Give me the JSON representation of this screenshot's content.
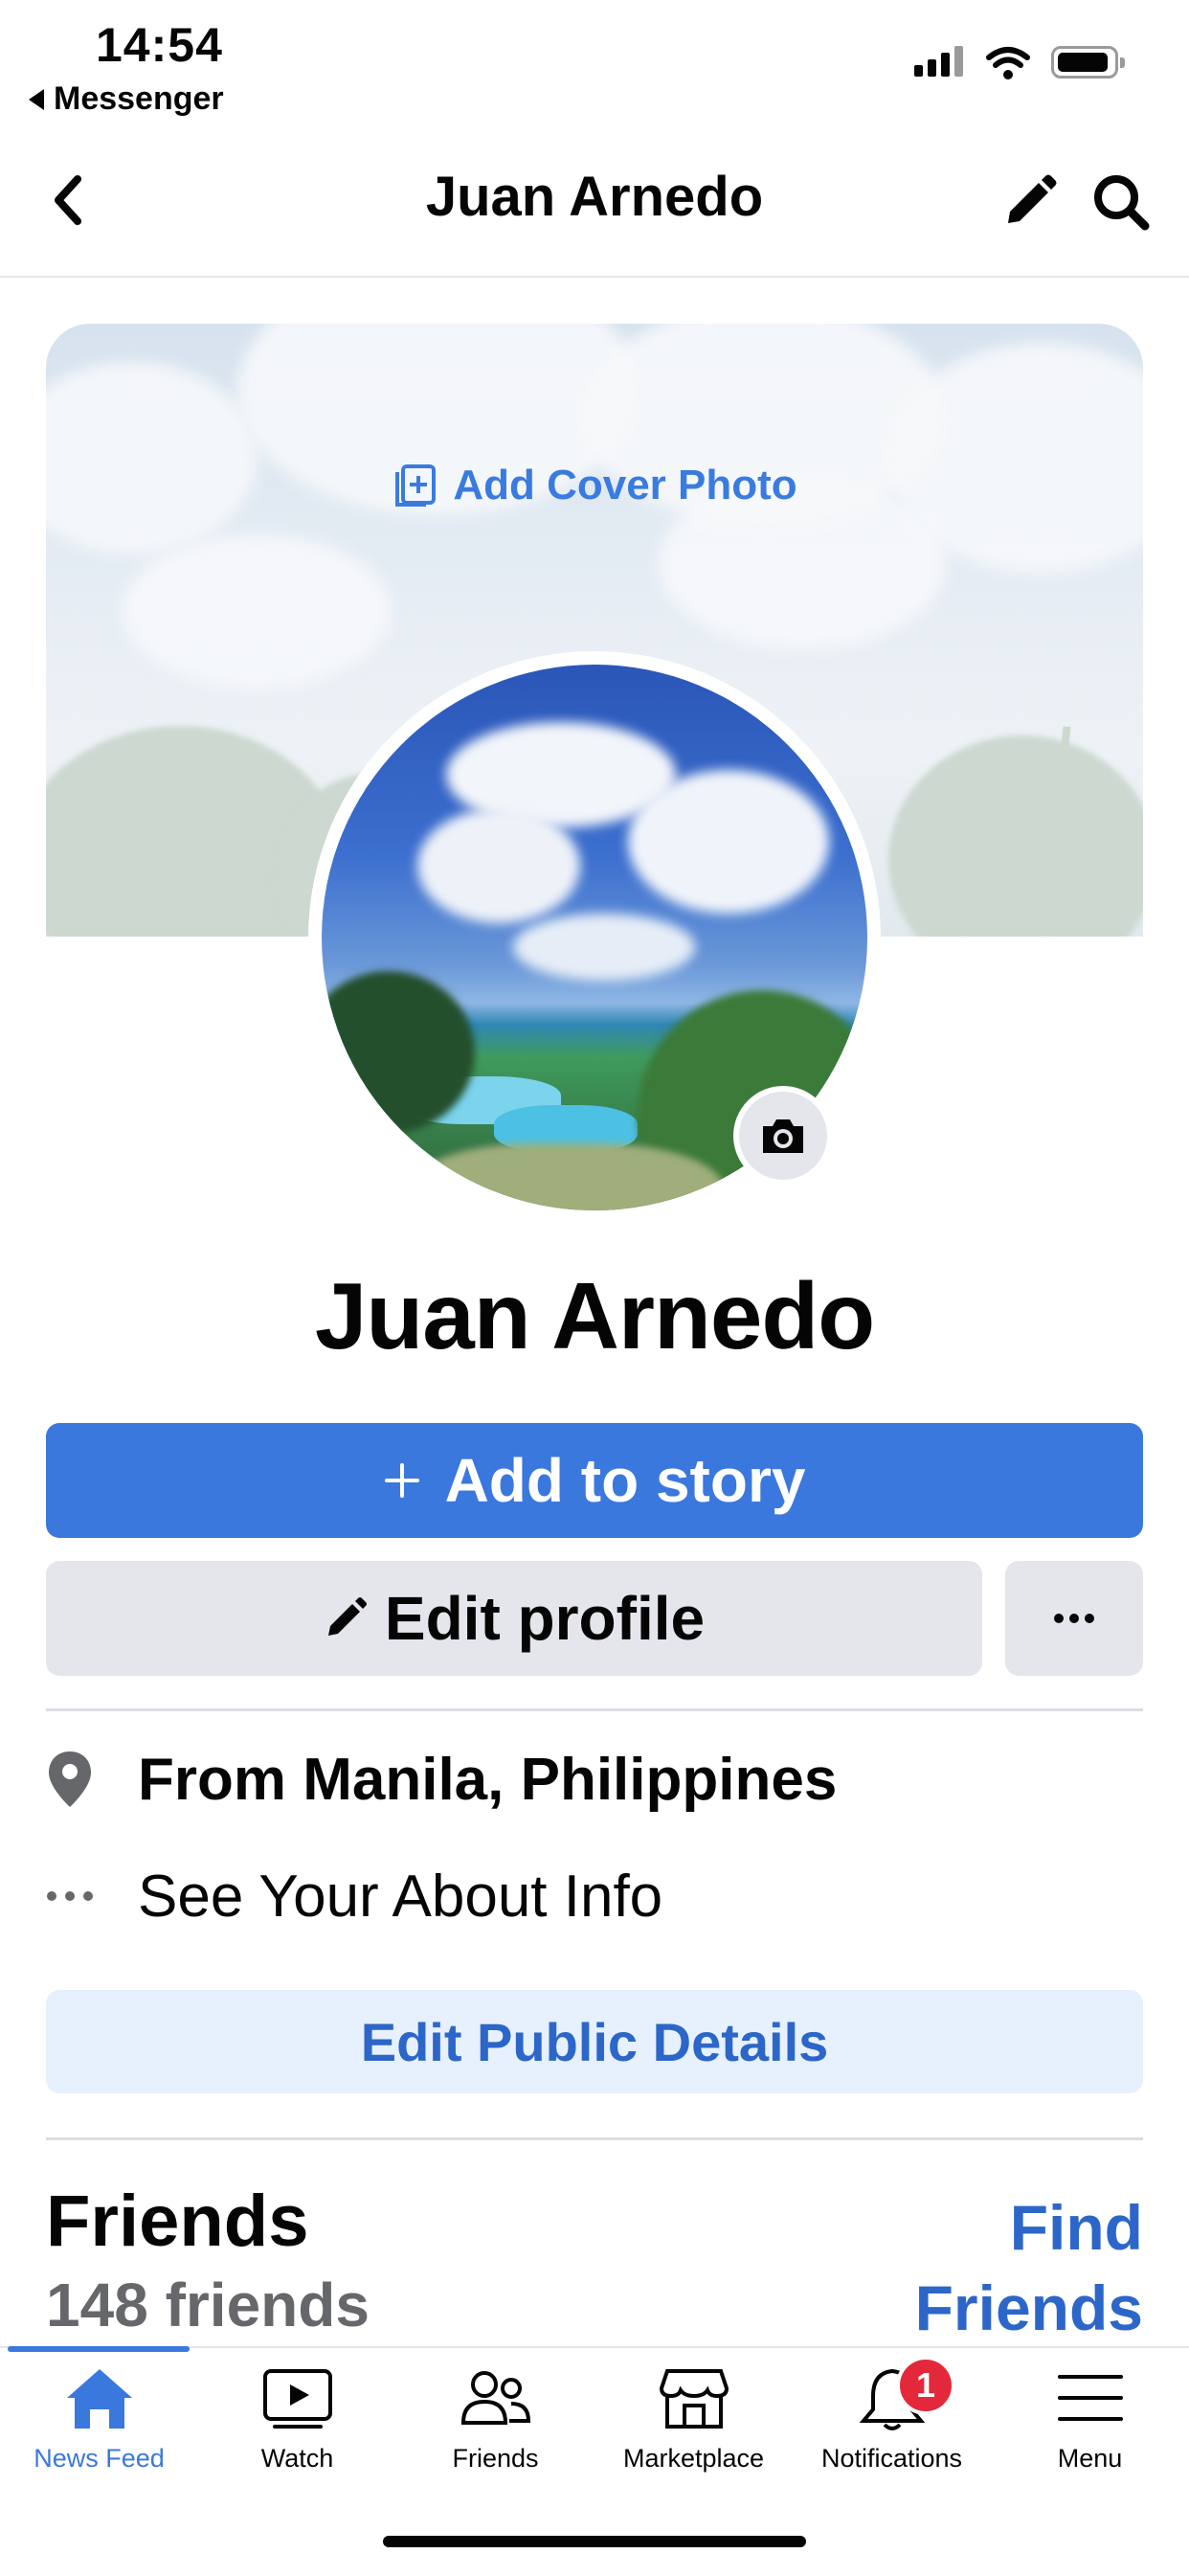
{
  "status_bar": {
    "time": "14:54",
    "back_app": "Messenger"
  },
  "nav": {
    "title": "Juan Arnedo",
    "back_icon": "chevron-left-icon",
    "edit_icon": "pencil-icon",
    "search_icon": "search-icon"
  },
  "cover": {
    "add_label": "Add Cover Photo"
  },
  "profile": {
    "name": "Juan Arnedo"
  },
  "actions": {
    "add_story": "Add to story",
    "edit_profile": "Edit profile",
    "more_icon": "ellipsis-icon"
  },
  "info": {
    "location": "From Manila, Philippines",
    "about": "See Your About Info",
    "edit_public": "Edit Public Details"
  },
  "friends": {
    "heading": "Friends",
    "count": "148 friends",
    "find_line1": "Find",
    "find_line2": "Friends"
  },
  "tabs": [
    {
      "label": "News Feed",
      "icon": "home-icon",
      "active": true
    },
    {
      "label": "Watch",
      "icon": "video-icon",
      "active": false
    },
    {
      "label": "Friends",
      "icon": "friends-icon",
      "active": false
    },
    {
      "label": "Marketplace",
      "icon": "shop-icon",
      "active": false
    },
    {
      "label": "Notifications",
      "icon": "bell-icon",
      "active": false
    },
    {
      "label": "Menu",
      "icon": "menu-icon",
      "active": false
    }
  ],
  "notifications_badge": "1",
  "colors": {
    "accent": "#3a78de",
    "link": "#2c66c8",
    "badge": "#e4283b",
    "button_gray": "#e4e6eb"
  }
}
